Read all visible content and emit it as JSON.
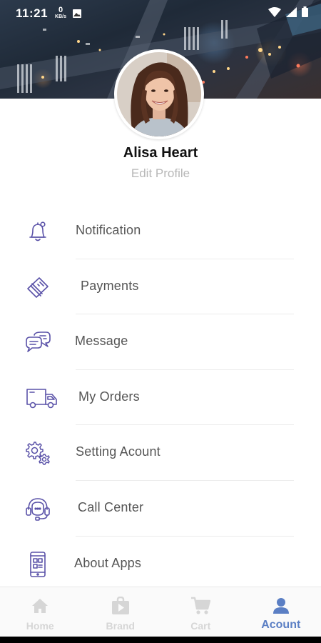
{
  "status_bar": {
    "time": "11:21",
    "net_speed": "0",
    "net_unit": "KB/s"
  },
  "profile": {
    "name": "Alisa Heart",
    "edit_label": "Edit Profile"
  },
  "menu": {
    "items": [
      {
        "label": "Notification",
        "icon": "bell-icon"
      },
      {
        "label": "Payments",
        "icon": "credit-card-icon"
      },
      {
        "label": "Message",
        "icon": "chat-bubbles-icon"
      },
      {
        "label": "My Orders",
        "icon": "delivery-truck-icon"
      },
      {
        "label": "Setting Acount",
        "icon": "gears-icon"
      },
      {
        "label": "Call Center",
        "icon": "headset-icon"
      },
      {
        "label": "About Apps",
        "icon": "mobile-app-icon"
      }
    ]
  },
  "bottom_nav": {
    "items": [
      {
        "label": "Home",
        "icon": "home-icon",
        "active": false
      },
      {
        "label": "Brand",
        "icon": "brand-bag-icon",
        "active": false
      },
      {
        "label": "Cart",
        "icon": "cart-icon",
        "active": false
      },
      {
        "label": "Acount",
        "icon": "user-icon",
        "active": true
      }
    ]
  },
  "colors": {
    "icon_accent": "#5a52a8",
    "nav_active": "#5b7fc4",
    "nav_inactive": "#d6d6d6",
    "label_text": "#555555",
    "edit_text": "#b7b7b7"
  }
}
